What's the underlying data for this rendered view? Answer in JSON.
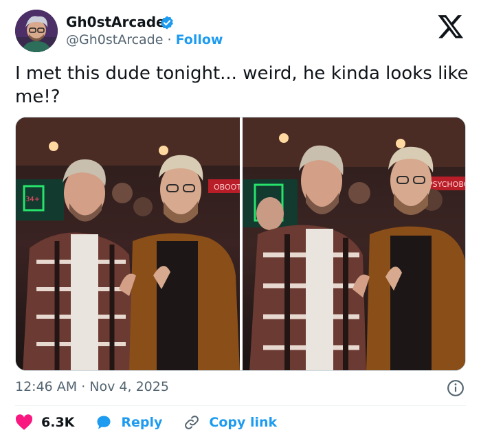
{
  "author": {
    "display_name": "Gh0stArcade",
    "handle": "@Gh0stArcade",
    "separator": "·",
    "follow_label": "Follow",
    "verified": true
  },
  "tweet": {
    "text": "I met this dude tonight... weird, he kinda looks like me!?",
    "timestamp": "12:46 AM · Nov 4, 2025"
  },
  "media": {
    "photo_count": 2,
    "left_sign_text": "OBOOT",
    "right_sign_text": "PSYCHOBO"
  },
  "actions": {
    "like_count": "6.3K",
    "reply_label": "Reply",
    "copy_label": "Copy link"
  },
  "colors": {
    "accent": "#1d9bf0",
    "like": "#f91880",
    "text": "#0f1419",
    "muted": "#536471"
  }
}
